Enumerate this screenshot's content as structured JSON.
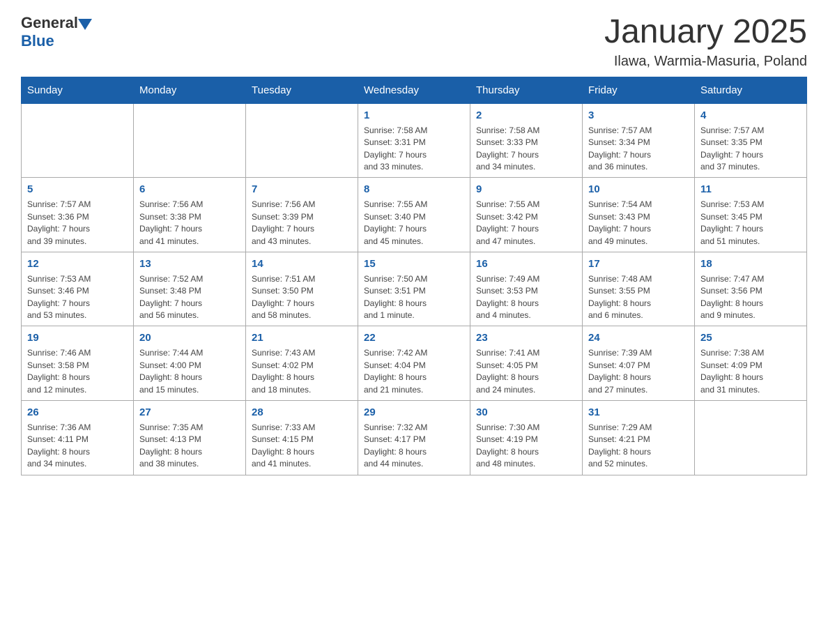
{
  "header": {
    "logo": {
      "general": "General",
      "blue": "Blue"
    },
    "title": "January 2025",
    "location": "Ilawa, Warmia-Masuria, Poland"
  },
  "weekdays": [
    "Sunday",
    "Monday",
    "Tuesday",
    "Wednesday",
    "Thursday",
    "Friday",
    "Saturday"
  ],
  "weeks": [
    [
      {
        "day": "",
        "info": ""
      },
      {
        "day": "",
        "info": ""
      },
      {
        "day": "",
        "info": ""
      },
      {
        "day": "1",
        "info": "Sunrise: 7:58 AM\nSunset: 3:31 PM\nDaylight: 7 hours\nand 33 minutes."
      },
      {
        "day": "2",
        "info": "Sunrise: 7:58 AM\nSunset: 3:33 PM\nDaylight: 7 hours\nand 34 minutes."
      },
      {
        "day": "3",
        "info": "Sunrise: 7:57 AM\nSunset: 3:34 PM\nDaylight: 7 hours\nand 36 minutes."
      },
      {
        "day": "4",
        "info": "Sunrise: 7:57 AM\nSunset: 3:35 PM\nDaylight: 7 hours\nand 37 minutes."
      }
    ],
    [
      {
        "day": "5",
        "info": "Sunrise: 7:57 AM\nSunset: 3:36 PM\nDaylight: 7 hours\nand 39 minutes."
      },
      {
        "day": "6",
        "info": "Sunrise: 7:56 AM\nSunset: 3:38 PM\nDaylight: 7 hours\nand 41 minutes."
      },
      {
        "day": "7",
        "info": "Sunrise: 7:56 AM\nSunset: 3:39 PM\nDaylight: 7 hours\nand 43 minutes."
      },
      {
        "day": "8",
        "info": "Sunrise: 7:55 AM\nSunset: 3:40 PM\nDaylight: 7 hours\nand 45 minutes."
      },
      {
        "day": "9",
        "info": "Sunrise: 7:55 AM\nSunset: 3:42 PM\nDaylight: 7 hours\nand 47 minutes."
      },
      {
        "day": "10",
        "info": "Sunrise: 7:54 AM\nSunset: 3:43 PM\nDaylight: 7 hours\nand 49 minutes."
      },
      {
        "day": "11",
        "info": "Sunrise: 7:53 AM\nSunset: 3:45 PM\nDaylight: 7 hours\nand 51 minutes."
      }
    ],
    [
      {
        "day": "12",
        "info": "Sunrise: 7:53 AM\nSunset: 3:46 PM\nDaylight: 7 hours\nand 53 minutes."
      },
      {
        "day": "13",
        "info": "Sunrise: 7:52 AM\nSunset: 3:48 PM\nDaylight: 7 hours\nand 56 minutes."
      },
      {
        "day": "14",
        "info": "Sunrise: 7:51 AM\nSunset: 3:50 PM\nDaylight: 7 hours\nand 58 minutes."
      },
      {
        "day": "15",
        "info": "Sunrise: 7:50 AM\nSunset: 3:51 PM\nDaylight: 8 hours\nand 1 minute."
      },
      {
        "day": "16",
        "info": "Sunrise: 7:49 AM\nSunset: 3:53 PM\nDaylight: 8 hours\nand 4 minutes."
      },
      {
        "day": "17",
        "info": "Sunrise: 7:48 AM\nSunset: 3:55 PM\nDaylight: 8 hours\nand 6 minutes."
      },
      {
        "day": "18",
        "info": "Sunrise: 7:47 AM\nSunset: 3:56 PM\nDaylight: 8 hours\nand 9 minutes."
      }
    ],
    [
      {
        "day": "19",
        "info": "Sunrise: 7:46 AM\nSunset: 3:58 PM\nDaylight: 8 hours\nand 12 minutes."
      },
      {
        "day": "20",
        "info": "Sunrise: 7:44 AM\nSunset: 4:00 PM\nDaylight: 8 hours\nand 15 minutes."
      },
      {
        "day": "21",
        "info": "Sunrise: 7:43 AM\nSunset: 4:02 PM\nDaylight: 8 hours\nand 18 minutes."
      },
      {
        "day": "22",
        "info": "Sunrise: 7:42 AM\nSunset: 4:04 PM\nDaylight: 8 hours\nand 21 minutes."
      },
      {
        "day": "23",
        "info": "Sunrise: 7:41 AM\nSunset: 4:05 PM\nDaylight: 8 hours\nand 24 minutes."
      },
      {
        "day": "24",
        "info": "Sunrise: 7:39 AM\nSunset: 4:07 PM\nDaylight: 8 hours\nand 27 minutes."
      },
      {
        "day": "25",
        "info": "Sunrise: 7:38 AM\nSunset: 4:09 PM\nDaylight: 8 hours\nand 31 minutes."
      }
    ],
    [
      {
        "day": "26",
        "info": "Sunrise: 7:36 AM\nSunset: 4:11 PM\nDaylight: 8 hours\nand 34 minutes."
      },
      {
        "day": "27",
        "info": "Sunrise: 7:35 AM\nSunset: 4:13 PM\nDaylight: 8 hours\nand 38 minutes."
      },
      {
        "day": "28",
        "info": "Sunrise: 7:33 AM\nSunset: 4:15 PM\nDaylight: 8 hours\nand 41 minutes."
      },
      {
        "day": "29",
        "info": "Sunrise: 7:32 AM\nSunset: 4:17 PM\nDaylight: 8 hours\nand 44 minutes."
      },
      {
        "day": "30",
        "info": "Sunrise: 7:30 AM\nSunset: 4:19 PM\nDaylight: 8 hours\nand 48 minutes."
      },
      {
        "day": "31",
        "info": "Sunrise: 7:29 AM\nSunset: 4:21 PM\nDaylight: 8 hours\nand 52 minutes."
      },
      {
        "day": "",
        "info": ""
      }
    ]
  ]
}
